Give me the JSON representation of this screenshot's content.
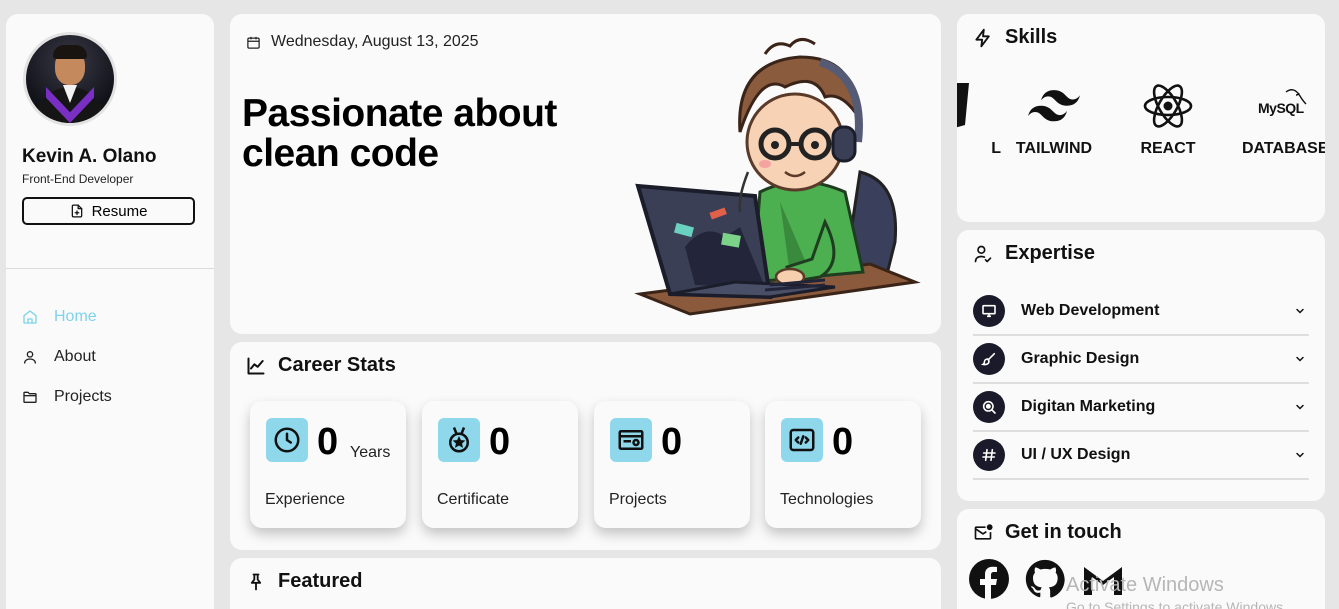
{
  "profile": {
    "name": "Kevin A. Olano",
    "role": "Front-End Developer",
    "resume_label": "Resume"
  },
  "nav": {
    "items": [
      {
        "label": "Home",
        "icon": "home-icon",
        "active": true
      },
      {
        "label": "About",
        "icon": "user-icon",
        "active": false
      },
      {
        "label": "Projects",
        "icon": "folder-icon",
        "active": false
      }
    ]
  },
  "hero": {
    "date": "Wednesday, August 13, 2025",
    "tagline": "Passionate about clean code"
  },
  "stats": {
    "title": "Career Stats",
    "items": [
      {
        "value": "0",
        "unit": "Years",
        "label": "Experience",
        "icon": "clock-icon"
      },
      {
        "value": "0",
        "unit": "",
        "label": "Certificate",
        "icon": "medal-icon"
      },
      {
        "value": "0",
        "unit": "",
        "label": "Projects",
        "icon": "project-icon"
      },
      {
        "value": "0",
        "unit": "",
        "label": "Technologies",
        "icon": "code-icon"
      }
    ]
  },
  "featured": {
    "title": "Featured"
  },
  "skills": {
    "title": "Skills",
    "items": [
      {
        "label": "L",
        "icon": "html-icon"
      },
      {
        "label": "TAILWIND",
        "icon": "tailwind-icon"
      },
      {
        "label": "REACT",
        "icon": "react-icon"
      },
      {
        "label": "DATABASE",
        "icon": "mysql-icon",
        "logo_text": "MySQL"
      }
    ]
  },
  "expertise": {
    "title": "Expertise",
    "items": [
      {
        "label": "Web Development",
        "icon": "monitor-icon"
      },
      {
        "label": "Graphic Design",
        "icon": "brush-icon"
      },
      {
        "label": "Digitan Marketing",
        "icon": "search-icon"
      },
      {
        "label": "UI / UX Design",
        "icon": "hash-icon"
      }
    ]
  },
  "contact": {
    "title": "Get in touch",
    "socials": [
      "facebook-icon",
      "github-icon",
      "gmail-icon"
    ]
  },
  "watermark": {
    "line1": "Activate Windows",
    "line2": "Go to Settings to activate Windows."
  },
  "colors": {
    "accent": "#7fd3ea",
    "stat_icon_bg": "#8fd8ec",
    "card_bg": "#fafafa",
    "page_bg": "#e6e6e6"
  }
}
